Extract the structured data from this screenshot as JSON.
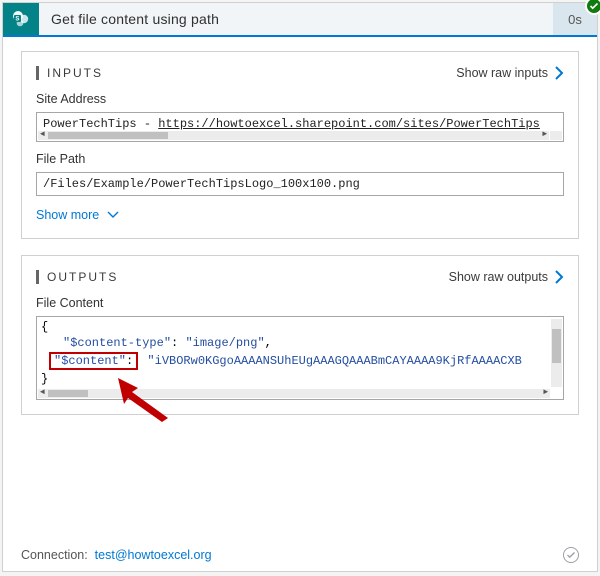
{
  "header": {
    "title": "Get file content using path",
    "duration": "0s"
  },
  "inputs": {
    "section_title": "INPUTS",
    "raw_label": "Show raw inputs",
    "site_address_label": "Site Address",
    "site_address_prefix": "PowerTechTips - ",
    "site_address_url": "https://howtoexcel.sharepoint.com/sites/PowerTechTips",
    "file_path_label": "File Path",
    "file_path_value": "/Files/Example/PowerTechTipsLogo_100x100.png",
    "show_more": "Show more"
  },
  "outputs": {
    "section_title": "OUTPUTS",
    "raw_label": "Show raw outputs",
    "file_content_label": "File Content",
    "json": {
      "open": "{",
      "ct_key": "\"$content-type\"",
      "ct_sep": ": ",
      "ct_val": "\"image/png\"",
      "comma": ",",
      "c_key": "\"$content\"",
      "c_sep": ": ",
      "c_val": "\"iVBORw0KGgoAAAANSUhEUgAAAGQAAABmCAYAAAA9KjRfAAAACXB",
      "close": "}"
    }
  },
  "footer": {
    "connection_label": "Connection:",
    "connection_value": "test@howtoexcel.org"
  }
}
